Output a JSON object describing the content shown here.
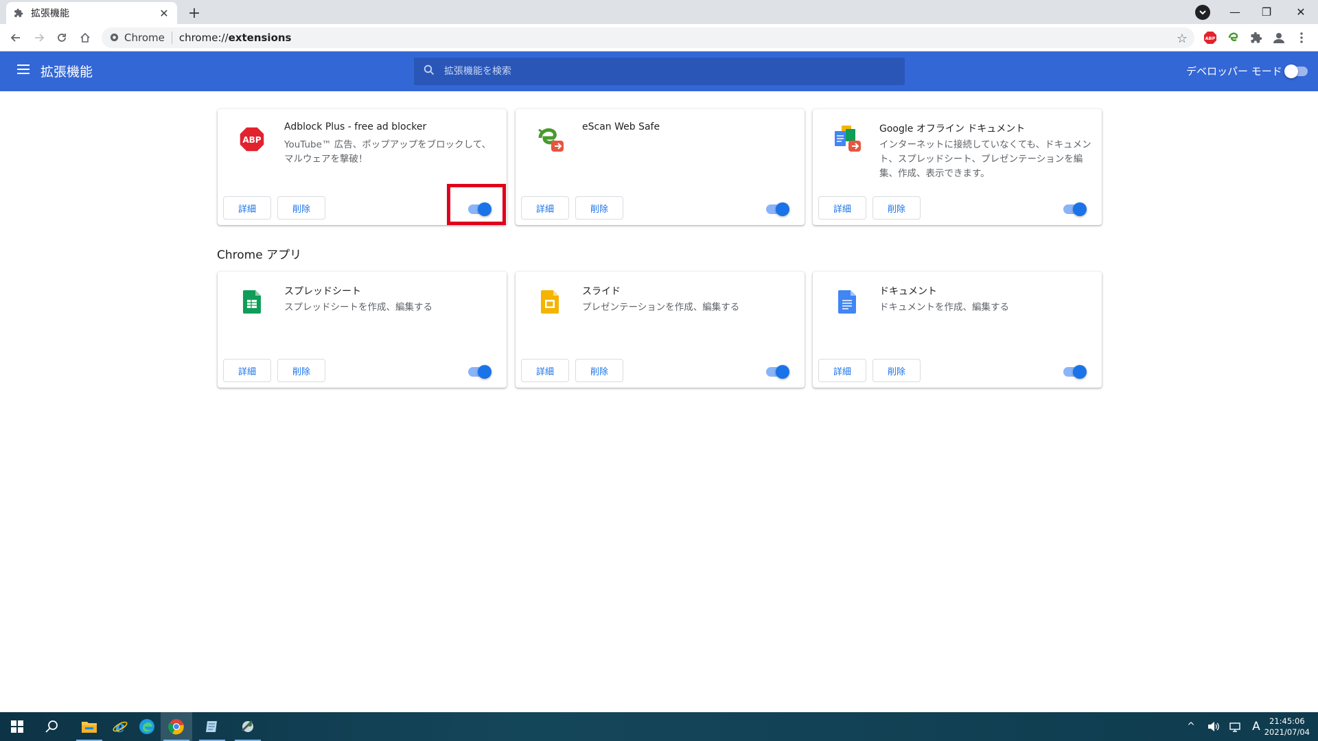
{
  "browser": {
    "tab": {
      "title": "拡張機能",
      "icon": "puzzle-icon",
      "close": "✕"
    },
    "newtab": "+",
    "window_controls": {
      "minimize": "—",
      "restore": "❐",
      "close": "✕"
    },
    "omnibox": {
      "site_chip": "Chrome",
      "url_scheme": "chrome://",
      "url_host": "extensions"
    },
    "toolbar_extensions": [
      "adblock-plus-icon",
      "escan-icon",
      "puzzle-icon",
      "profile-icon",
      "more-icon"
    ]
  },
  "header": {
    "title": "拡張機能",
    "search_placeholder": "拡張機能を検索",
    "devmode_label": "デベロッパー モード",
    "devmode_on": false,
    "accent": "#3367d6"
  },
  "extensions": [
    {
      "name": "Adblock Plus - free ad blocker",
      "description": "YouTube™ 広告、ポップアップをブロックして、マルウェアを撃破！",
      "details": "詳細",
      "remove": "削除",
      "enabled": true,
      "icon": "abp-icon"
    },
    {
      "name": "eScan Web Safe",
      "description": "",
      "details": "詳細",
      "remove": "削除",
      "enabled": true,
      "icon": "escan-icon"
    },
    {
      "name": "Google オフライン ドキュメント",
      "description": "インターネットに接続していなくても、ドキュメント、スプレッドシート、プレゼンテーションを編集、作成、表示できます。",
      "details": "詳細",
      "remove": "削除",
      "enabled": true,
      "icon": "offline-docs-icon"
    }
  ],
  "apps_section": {
    "heading": "Chrome アプリ"
  },
  "apps": [
    {
      "name": "スプレッドシート",
      "description": "スプレッドシートを作成、編集する",
      "details": "詳細",
      "remove": "削除",
      "enabled": true,
      "icon": "sheets-icon"
    },
    {
      "name": "スライド",
      "description": "プレゼンテーションを作成、編集する",
      "details": "詳細",
      "remove": "削除",
      "enabled": true,
      "icon": "slides-icon"
    },
    {
      "name": "ドキュメント",
      "description": "ドキュメントを作成、編集する",
      "details": "詳細",
      "remove": "削除",
      "enabled": true,
      "icon": "docs-icon"
    }
  ],
  "taskbar": {
    "items": [
      "windows-start-icon",
      "search-icon",
      "file-explorer-icon",
      "internet-explorer-icon",
      "edge-icon",
      "chrome-icon",
      "notes-icon",
      "tool-icon"
    ],
    "tray": {
      "chevron": "^",
      "volume": "🔊",
      "ime": "A"
    },
    "time": "21:45:06",
    "date": "2021/07/04"
  }
}
